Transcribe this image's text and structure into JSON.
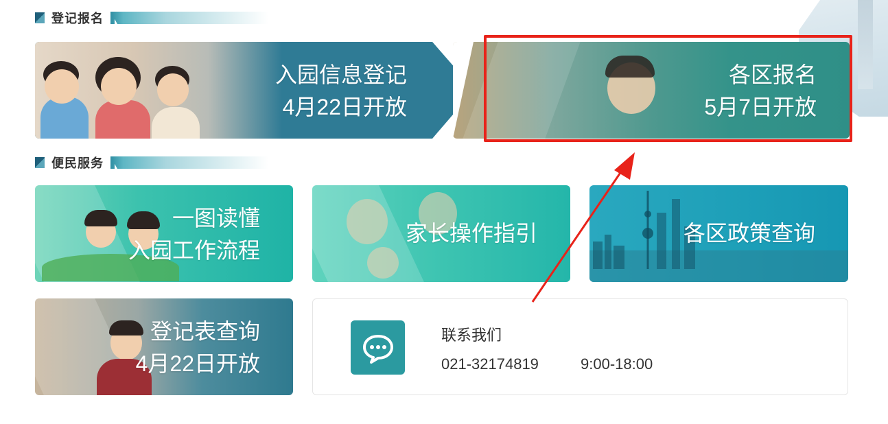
{
  "sections": {
    "register": {
      "title": "登记报名"
    },
    "services": {
      "title": "便民服务"
    }
  },
  "cards": {
    "register": {
      "line1": "入园信息登记",
      "line2": "4月22日开放"
    },
    "district": {
      "line1": "各区报名",
      "line2": "5月7日开放"
    },
    "flow": {
      "line1": "一图读懂",
      "line2": "入园工作流程"
    },
    "guide": {
      "line1": "家长操作指引"
    },
    "policy": {
      "line1": "各区政策查询"
    },
    "query": {
      "line1": "登记表查询",
      "line2": "4月22日开放"
    }
  },
  "contact": {
    "title": "联系我们",
    "phone": "021-32174819",
    "hours": "9:00-18:00",
    "icon": "chat-bubble-icon"
  },
  "colors": {
    "highlight": "#e8231a",
    "teal": "#2b9aa0",
    "register_card": "#2f7b95",
    "district_card": "#2f8f87"
  }
}
